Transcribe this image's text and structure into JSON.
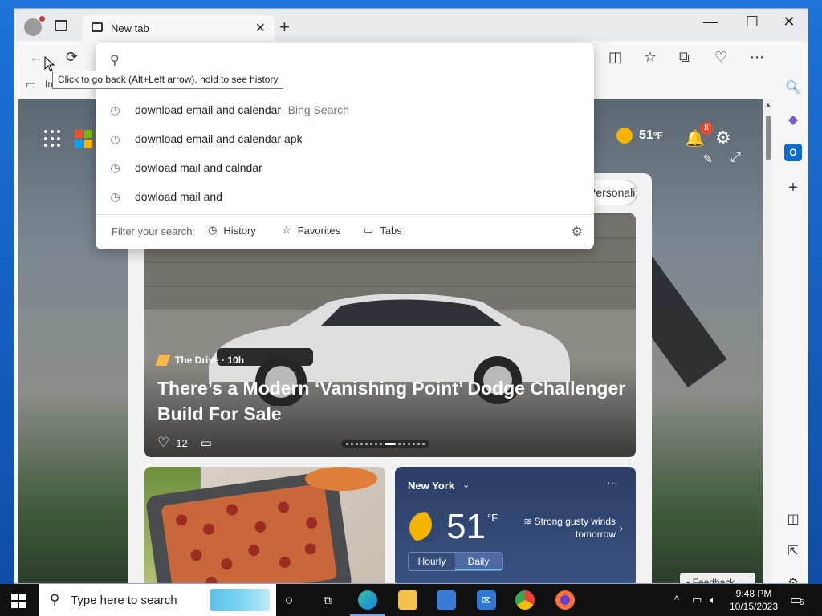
{
  "browser": {
    "tab_title": "New tab",
    "tab_close": "✕",
    "new_tab": "+",
    "window_controls": [
      "—",
      "☐",
      "✕"
    ],
    "favorites_label": "In"
  },
  "tooltip": {
    "text": "Click to go back (Alt+Left arrow), hold to see history"
  },
  "omnibox": {
    "placeholder": "",
    "suggestions": [
      {
        "text": "download email and calendar",
        "source": " - Bing Search"
      },
      {
        "text": "download email and calendar apk",
        "source": ""
      },
      {
        "text": "dowload mail and calndar",
        "source": ""
      },
      {
        "text": "dowload mail and",
        "source": ""
      }
    ],
    "filter_label": "Filter your search:",
    "filters": [
      "History",
      "Favorites",
      "Tabs"
    ]
  },
  "msn": {
    "weather_temp": "51",
    "weather_unit": "°F",
    "notification_count": "8",
    "personalize_label": "Personalize",
    "hero": {
      "source": "The Drive · 10h",
      "title": "There’s a Modern ‘Vanishing Point’ Dodge Challenger Build For Sale",
      "likes": "12"
    },
    "weather_card": {
      "city": "New York",
      "temp": "51",
      "unit": "°F",
      "wind_line1": "Strong gusty winds",
      "wind_line2": "tomorrow",
      "tab_hourly": "Hourly",
      "tab_daily": "Daily"
    },
    "feedback_label": "Feedback"
  },
  "taskbar": {
    "search_placeholder": "Type here to search",
    "time": "9:48 PM",
    "date": "10/15/2023",
    "notification_count": "5"
  },
  "colors": {
    "accent": "#0078d4",
    "badge": "#e8492f"
  }
}
